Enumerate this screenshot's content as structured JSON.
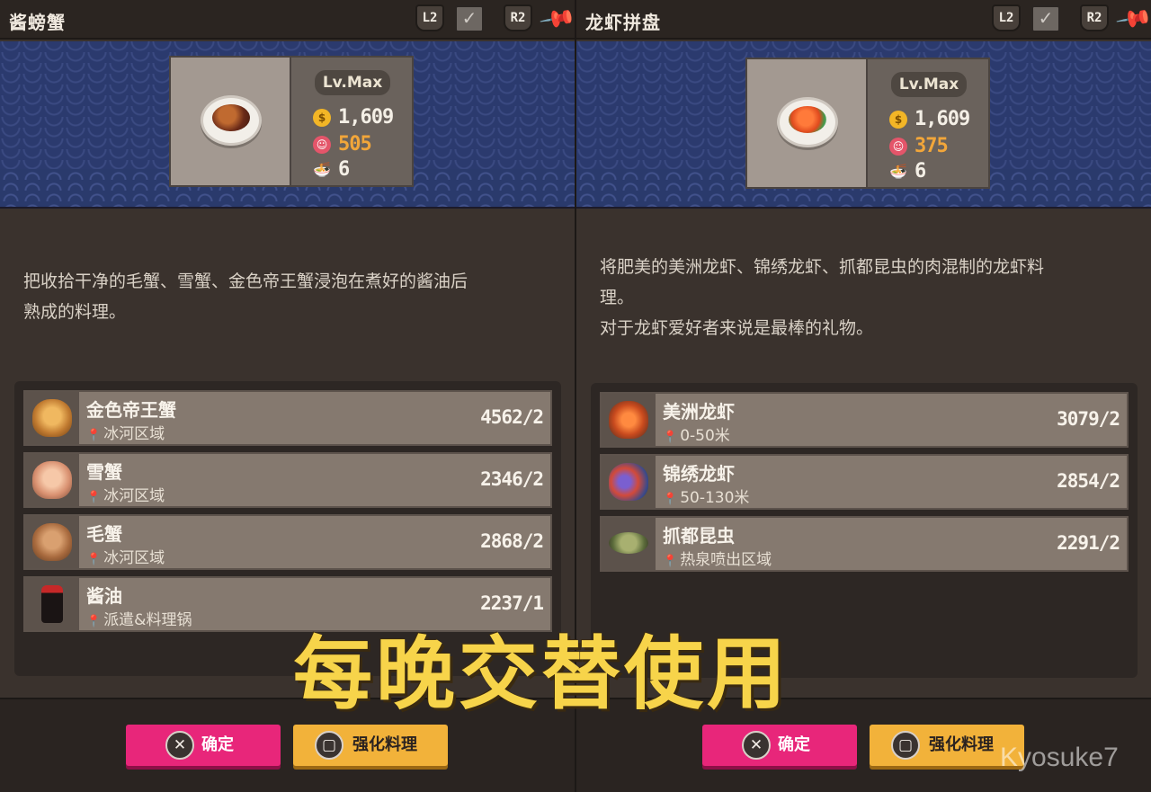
{
  "panels": [
    {
      "title": "酱螃蟹",
      "hud": {
        "l2": "L2",
        "r2": "R2"
      },
      "level": "Lv.Max",
      "stats": {
        "price": "1,609",
        "taste": "505",
        "portions": "6"
      },
      "description": [
        "把收拾干净的毛蟹、雪蟹、金色帝王蟹浸泡在煮好的酱油后",
        "熟成的料理。"
      ],
      "ingredients": [
        {
          "name": "金色帝王蟹",
          "location": "冰河区域",
          "count": "4562/2",
          "icon": "golden-king-crab-icon"
        },
        {
          "name": "雪蟹",
          "location": "冰河区域",
          "count": "2346/2",
          "icon": "snow-crab-icon"
        },
        {
          "name": "毛蟹",
          "location": "冰河区域",
          "count": "2868/2",
          "icon": "hairy-crab-icon"
        },
        {
          "name": "酱油",
          "location": "派遣&料理锅",
          "count": "2237/1",
          "icon": "soy-sauce-icon"
        }
      ],
      "buttons": {
        "confirm_glyph": "✕",
        "confirm": "确定",
        "upgrade_glyph": "▢",
        "upgrade": "强化料理"
      }
    },
    {
      "title": "龙虾拼盘",
      "hud": {
        "l2": "L2",
        "r2": "R2"
      },
      "level": "Lv.Max",
      "stats": {
        "price": "1,609",
        "taste": "375",
        "portions": "6"
      },
      "description": [
        "将肥美的美洲龙虾、锦绣龙虾、抓都昆虫的肉混制的龙虾料",
        "理。",
        "对于龙虾爱好者来说是最棒的礼物。"
      ],
      "ingredients": [
        {
          "name": "美洲龙虾",
          "location": "0-50米",
          "count": "3079/2",
          "icon": "american-lobster-icon"
        },
        {
          "name": "锦绣龙虾",
          "location": "50-130米",
          "count": "2854/2",
          "icon": "ornate-lobster-icon"
        },
        {
          "name": "抓都昆虫",
          "location": "热泉喷出区域",
          "count": "2291/2",
          "icon": "sea-bug-icon"
        }
      ],
      "buttons": {
        "confirm_glyph": "✕",
        "confirm": "确定",
        "upgrade_glyph": "▢",
        "upgrade": "强化料理"
      }
    }
  ],
  "overlay_caption": "每晚交替使用",
  "watermark": "Kyosuke7",
  "colors": {
    "confirm": "#e8267a",
    "upgrade": "#f2b23a",
    "caption": "#f7d44a",
    "banner": "#2b3a6e"
  }
}
